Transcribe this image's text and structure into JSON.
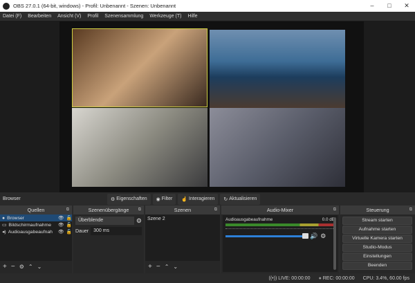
{
  "window": {
    "title": "OBS 27.0.1 (64-bit, windows) - Profil: Unbenannt - Szenen: Unbenannt"
  },
  "menu": [
    "Datei (F)",
    "Bearbeiten",
    "Ansicht (V)",
    "Profil",
    "Szenensammlung",
    "Werkzeuge (T)",
    "Hilfe"
  ],
  "source_toolbar": {
    "selected": "Browser",
    "properties": "Eigenschaften",
    "filter": "Filter",
    "interact": "Interagieren",
    "refresh": "Aktualisieren"
  },
  "docks": {
    "sources": {
      "title": "Quellen",
      "items": [
        "Browser",
        "Bildschirmaufnahme",
        "Audioausgabeaufnah"
      ]
    },
    "transitions": {
      "title": "Szenenübergänge",
      "selected": "Überblende",
      "duration_label": "Dauer",
      "duration": "300 ms"
    },
    "scenes": {
      "title": "Szenen",
      "items": [
        "Szene 2"
      ]
    },
    "mixer": {
      "title": "Audio-Mixer",
      "channel": "Audioausgabeaufnahme",
      "level": "0.0 dB",
      "volume_fraction": 0.95
    },
    "controls": {
      "title": "Steuerung",
      "buttons": [
        "Stream starten",
        "Aufnahme starten",
        "Virtuelle Kamera starten",
        "Studio-Modus",
        "Einstellungen",
        "Beenden"
      ]
    }
  },
  "status": {
    "live": "LIVE: 00:00:00",
    "rec": "REC: 00:00:00",
    "cpu": "CPU: 3.4%, 60.00 fps"
  }
}
